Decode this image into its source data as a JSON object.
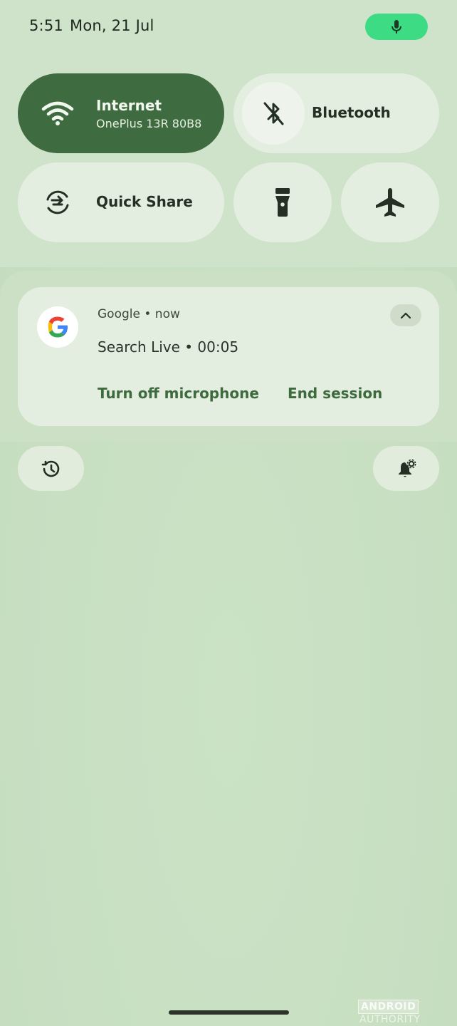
{
  "status_bar": {
    "time": "5:51",
    "date": "Mon, 21 Jul",
    "mic_indicator_icon": "mic-icon",
    "mic_indicator_color": "#3ddc84"
  },
  "quick_settings": {
    "tiles": [
      {
        "label": "Internet",
        "sublabel": "OnePlus 13R 80B8",
        "icon": "wifi-icon",
        "active": true
      },
      {
        "label": "Bluetooth",
        "icon": "bluetooth-off-icon",
        "active": false
      },
      {
        "label": "Quick Share",
        "icon": "quick-share-icon",
        "active": false
      },
      {
        "label": "",
        "icon": "flashlight-icon",
        "active": false
      },
      {
        "label": "",
        "icon": "airplane-icon",
        "active": false
      }
    ],
    "active_color": "#3f6b40",
    "inactive_color": "#e4eee0"
  },
  "notification": {
    "app": "Google",
    "separator": "•",
    "time": "now",
    "text": "Search Live • 00:05",
    "actions": [
      {
        "label": "Turn off microphone"
      },
      {
        "label": "End session"
      }
    ],
    "accent_color": "#3d6b3e"
  },
  "bottom_buttons": {
    "left_icon": "history-icon",
    "right_icon": "notification-settings-icon"
  },
  "watermark": {
    "part1": "ANDROID",
    "part2": "AUTHORITY"
  }
}
